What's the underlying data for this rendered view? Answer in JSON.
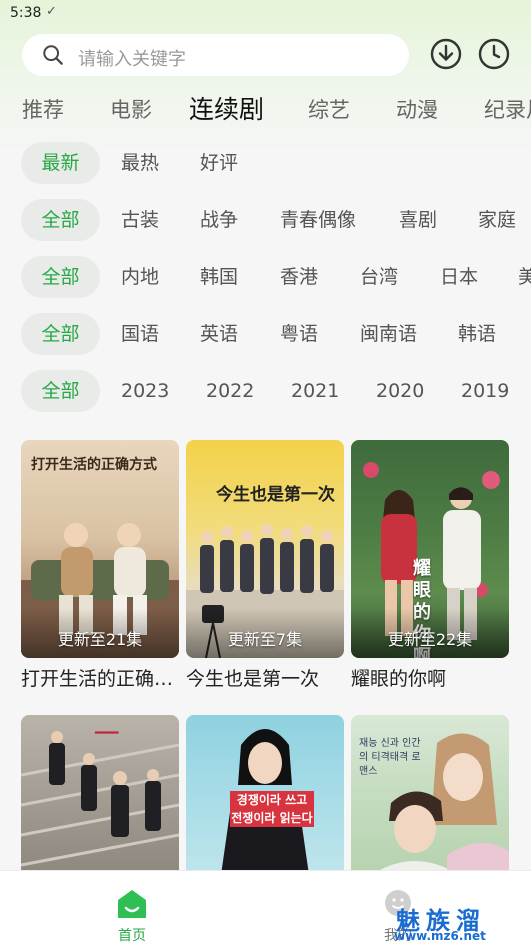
{
  "status_bar": {
    "time": "5:38",
    "check_mark": "✓"
  },
  "search": {
    "placeholder": "请输入关键字",
    "icon": "search-icon"
  },
  "header_icons": {
    "download": "download-icon",
    "history": "clock-icon"
  },
  "tabs": [
    "推荐",
    "电影",
    "连续剧",
    "综艺",
    "动漫",
    "纪录片"
  ],
  "active_tab": "连续剧",
  "filters": {
    "sort": [
      "最新",
      "最热",
      "好评"
    ],
    "genre": [
      "全部",
      "古装",
      "战争",
      "青春偶像",
      "喜剧",
      "家庭"
    ],
    "region": [
      "全部",
      "内地",
      "韩国",
      "香港",
      "台湾",
      "日本",
      "美国"
    ],
    "language": [
      "全部",
      "国语",
      "英语",
      "粤语",
      "闽南语",
      "韩语"
    ],
    "year": [
      "全部",
      "2023",
      "2022",
      "2021",
      "2020",
      "2019"
    ]
  },
  "accent_color": "#26a845",
  "cards": [
    {
      "title": "打开生活的正确方式",
      "display_title": "打开生活的正确…",
      "badge": "更新至21集",
      "poster_text": "打开生活的正确方式"
    },
    {
      "title": "今生也是第一次",
      "display_title": "今生也是第一次",
      "badge": "更新至7集",
      "poster_text": "今生也是第一次"
    },
    {
      "title": "耀眼的你啊",
      "display_title": "耀眼的你啊",
      "badge": "更新至22集",
      "poster_text": "耀眼的你啊"
    }
  ],
  "cards_row2": [
    {
      "title": ""
    },
    {
      "title": "",
      "poster_text": "경쟁이라 쓰고 전쟁이라 읽는다"
    },
    {
      "title": "",
      "poster_text": "재능 신과 인간의 티격태격 로맨스"
    }
  ],
  "bottom_nav": {
    "home_label": "首页",
    "mine_label": "我的"
  },
  "watermark": {
    "title": "魅族溜",
    "url": "www.mz6.net"
  }
}
